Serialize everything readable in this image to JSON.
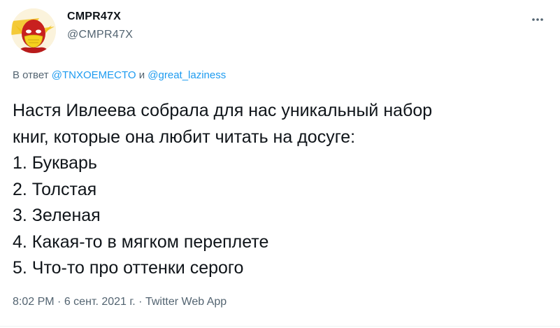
{
  "user": {
    "display_name": "CMPR47X",
    "handle": "@CMPR47X"
  },
  "reply": {
    "prefix": "В ответ",
    "mention1": "@TNXOEMECTO",
    "conjunction": "и",
    "mention2": "@great_laziness"
  },
  "tweet": {
    "lines": [
      "Настя Ивлеева собрала для нас уникальный набор",
      "книг, которые она любит читать на досуге:",
      "1. Букварь",
      "2. Толстая",
      "3. Зеленая",
      "4. Какая-то в мягком переплете",
      "5. Что-то про оттенки серого"
    ]
  },
  "meta": {
    "time": "8:02 PM",
    "separator": "·",
    "date": "6 сент. 2021 г.",
    "source": "Twitter Web App"
  },
  "icons": {
    "more": "more-dots-icon",
    "avatar": "avatar-flash-mask-icon"
  },
  "colors": {
    "text": "#0f1419",
    "secondary": "#536471",
    "link": "#1d9bf0"
  }
}
